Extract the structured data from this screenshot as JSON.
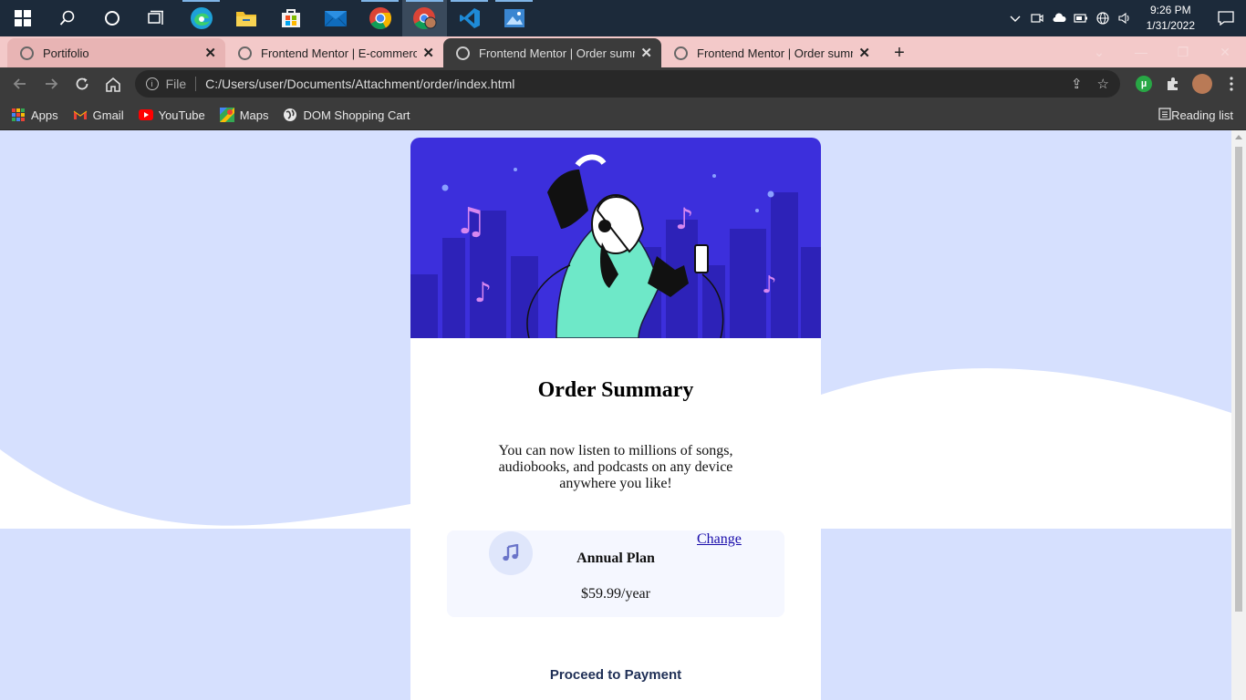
{
  "taskbar": {
    "time": "9:26 PM",
    "date": "1/31/2022",
    "apps": [
      {
        "name": "windows-start",
        "icon": "windows-logo"
      },
      {
        "name": "search",
        "icon": "search-icon"
      },
      {
        "name": "cortana",
        "icon": "circle-icon"
      },
      {
        "name": "task-view",
        "icon": "task-view-icon"
      },
      {
        "name": "edge",
        "icon": "edge-icon",
        "color": "#1ea1d8"
      },
      {
        "name": "file-explorer",
        "icon": "folder-icon",
        "color": "#f2c12e"
      },
      {
        "name": "store",
        "icon": "store-icon",
        "color": "#2b88d8"
      },
      {
        "name": "mail",
        "icon": "mail-icon",
        "color": "#0f6cbd"
      },
      {
        "name": "chrome",
        "icon": "chrome-icon",
        "color": "#db4437"
      },
      {
        "name": "chrome-profile",
        "icon": "chrome-profile-icon",
        "color": "#db4437"
      },
      {
        "name": "vscode",
        "icon": "vscode-icon",
        "color": "#1e8ad6"
      },
      {
        "name": "photos",
        "icon": "photos-icon",
        "color": "#3a86d1"
      }
    ]
  },
  "tabs": [
    {
      "title": "Portifolio"
    },
    {
      "title": "Frontend Mentor | E-commerce p"
    },
    {
      "title": "Frontend Mentor | Order summar"
    },
    {
      "title": "Frontend Mentor | Order summar"
    }
  ],
  "toolbar": {
    "scheme": "File",
    "url": "C:/Users/user/Documents/Attachment/order/index.html"
  },
  "bookmarks": [
    {
      "label": "Apps"
    },
    {
      "label": "Gmail"
    },
    {
      "label": "YouTube"
    },
    {
      "label": "Maps"
    },
    {
      "label": "DOM Shopping Cart"
    }
  ],
  "reading_list": "Reading list",
  "card": {
    "title": "Order Summary",
    "description": "You can now listen to millions of songs, audiobooks, and podcasts on any device anywhere you like!",
    "plan_name": "Annual Plan",
    "plan_price": "$59.99/year",
    "change_link": "Change",
    "proceed": "Proceed to Payment"
  },
  "colors": {
    "page_bg": "#d6e0fe",
    "hero_bg": "#3c2fdc",
    "accent_teal": "#6ee8c8"
  }
}
